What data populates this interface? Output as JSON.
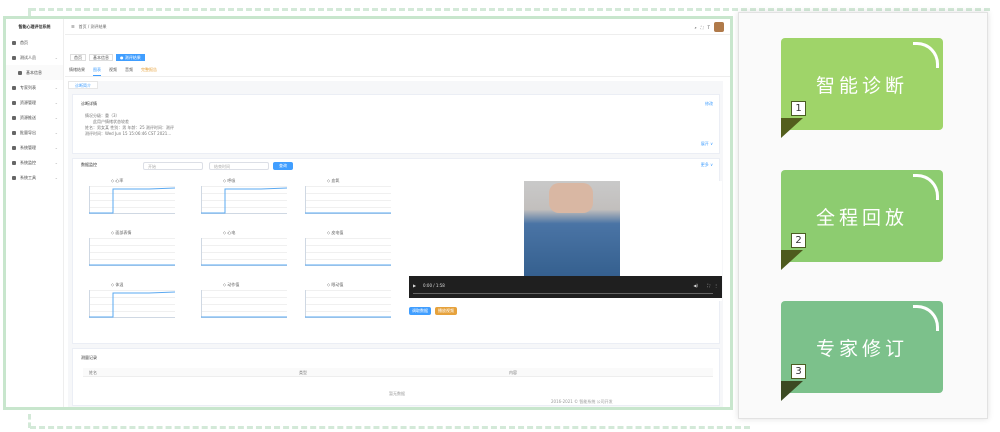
{
  "features": {
    "cards": [
      {
        "label": "智能诊断",
        "num": "1"
      },
      {
        "label": "全程回放",
        "num": "2"
      },
      {
        "label": "专家修订",
        "num": "3"
      }
    ]
  },
  "app": {
    "logo": "智能心理评估系统",
    "breadcrumb": "首页 / 测评结果",
    "menu": [
      {
        "label": "首页"
      },
      {
        "label": "测试人员"
      },
      {
        "label": "基本信息"
      },
      {
        "label": "专家列表"
      },
      {
        "label": "资源管理"
      },
      {
        "label": "资源推送"
      },
      {
        "label": "批量导出"
      },
      {
        "label": "系统管理"
      },
      {
        "label": "系统监控"
      },
      {
        "label": "系统工具"
      }
    ],
    "tags": [
      {
        "label": "首页"
      },
      {
        "label": "基本信息"
      },
      {
        "label": "● 测评结果"
      }
    ],
    "tabs": [
      {
        "label": "情绪结果"
      },
      {
        "label": "图表"
      },
      {
        "label": "视频"
      },
      {
        "label": "音频"
      },
      {
        "label": "完整报告"
      }
    ],
    "subtab": "诊断简介",
    "panel1": {
      "title": "诊断详情",
      "link": "修改",
      "more": "展开 ∨",
      "lines": [
        "情况分级：重（3）",
        "此用户情绪状态较差",
        "姓名：男女某 性别：男 年龄：25 测评时间：测评",
        "测评时间：Wed Jun 15 15:06:46 CST 2021..."
      ]
    },
    "panel2": {
      "title": "数据监控",
      "start_placeholder": "开始",
      "end_placeholder": "结束时间",
      "search_button": "查询",
      "more": "更多 ∨",
      "video_time": "0:00 / 1:58",
      "btn_a": "调取数据",
      "btn_b": "播放视频"
    },
    "charts": [
      {
        "legend": "心率"
      },
      {
        "legend": "呼吸"
      },
      {
        "legend": "血氧"
      },
      {
        "legend": "面部表情"
      },
      {
        "legend": "心电"
      },
      {
        "legend": "皮电值"
      },
      {
        "legend": "体温"
      },
      {
        "legend": "动作值"
      },
      {
        "legend": "眼动值"
      }
    ],
    "panel3": {
      "title": "测量记录",
      "cols": [
        "姓名",
        "类型",
        "内容"
      ]
    },
    "footer_left": "暂无数据",
    "footer_right": "2016-2021 © 智能系统 公司开发"
  },
  "colors": {
    "accent": "#409eff",
    "card1": "#9fd469",
    "card2": "#8dcc70",
    "card3": "#7cc18b"
  }
}
